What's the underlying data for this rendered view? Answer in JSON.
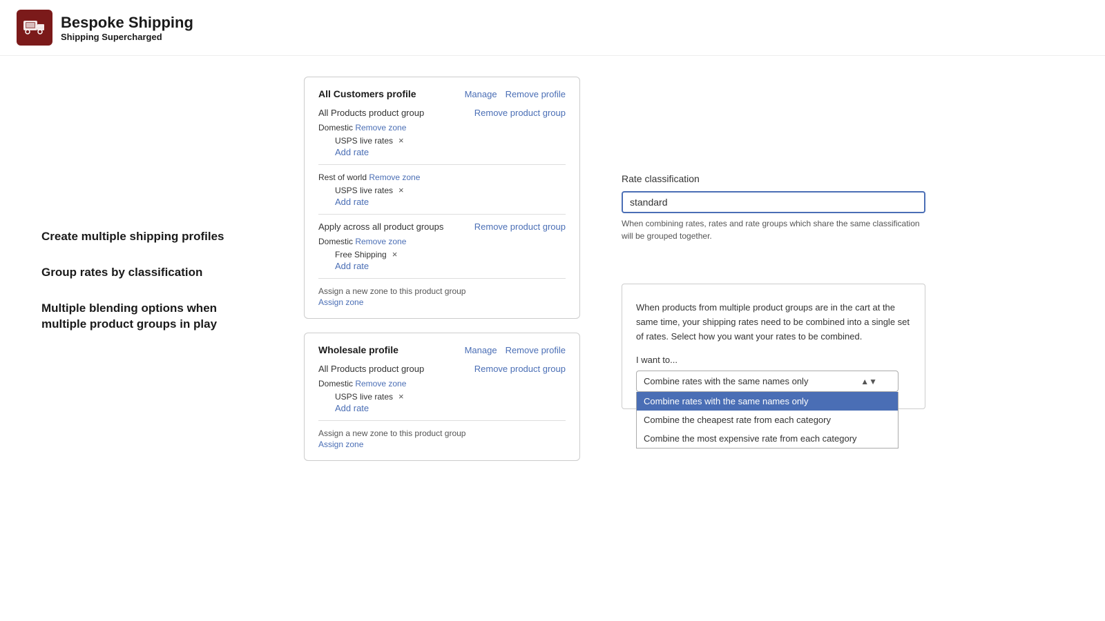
{
  "header": {
    "logo_title": "Bespoke Shipping",
    "logo_subtitle_normal": "Shipping ",
    "logo_subtitle_bold": "Supercharged"
  },
  "features": [
    "Create multiple shipping profiles",
    "Group rates by classification",
    "Multiple blending options when multiple product groups in play"
  ],
  "profiles": [
    {
      "id": "all-customers",
      "title": "All Customers profile",
      "actions": [
        "Manage",
        "Remove profile"
      ],
      "product_groups": [
        {
          "title": "All Products product group",
          "remove_label": "Remove product group",
          "zones": [
            {
              "label": "Domestic",
              "remove_label": "Remove zone",
              "rates": [
                {
                  "name": "USPS live rates",
                  "removable": true
                },
                {
                  "name": "Add rate",
                  "is_link": true
                }
              ]
            },
            {
              "label": "Rest of world",
              "remove_label": "Remove zone",
              "rates": [
                {
                  "name": "USPS live rates",
                  "removable": true
                },
                {
                  "name": "Add rate",
                  "is_link": true
                }
              ]
            }
          ]
        },
        {
          "title": "Apply across all product groups",
          "remove_label": "Remove product group",
          "zones": [
            {
              "label": "Domestic",
              "remove_label": "Remove zone",
              "rates": [
                {
                  "name": "Free Shipping",
                  "removable": true
                },
                {
                  "name": "Add rate",
                  "is_link": true
                }
              ]
            }
          ],
          "assign_zone": true
        }
      ]
    },
    {
      "id": "wholesale",
      "title": "Wholesale profile",
      "actions": [
        "Manage",
        "Remove profile"
      ],
      "product_groups": [
        {
          "title": "All Products product group",
          "remove_label": "Remove product group",
          "zones": [
            {
              "label": "Domestic",
              "remove_label": "Remove zone",
              "rates": [
                {
                  "name": "USPS live rates",
                  "removable": true
                },
                {
                  "name": "Add rate",
                  "is_link": true
                }
              ]
            }
          ],
          "assign_zone": true
        }
      ]
    }
  ],
  "right_panel": {
    "rate_classification": {
      "title": "Rate classification",
      "input_value": "standard",
      "helper_text": "When combining rates, rates and rate groups which share the same classification will be grouped together."
    },
    "combine_rates": {
      "description": "When products from multiple product groups are in the cart at the same time, your shipping rates need to be combined into a single set of rates. Select how you want your rates to be combined.",
      "i_want_label": "I want to...",
      "selected_option": "Combine rates with the same names only",
      "options": [
        "Combine rates with the same names only",
        "Combine the cheapest rate from each category",
        "Combine the most expensive rate from each category"
      ]
    }
  },
  "assign_zone_label": "Assign a new zone to this product group",
  "assign_zone_link": "Assign zone"
}
